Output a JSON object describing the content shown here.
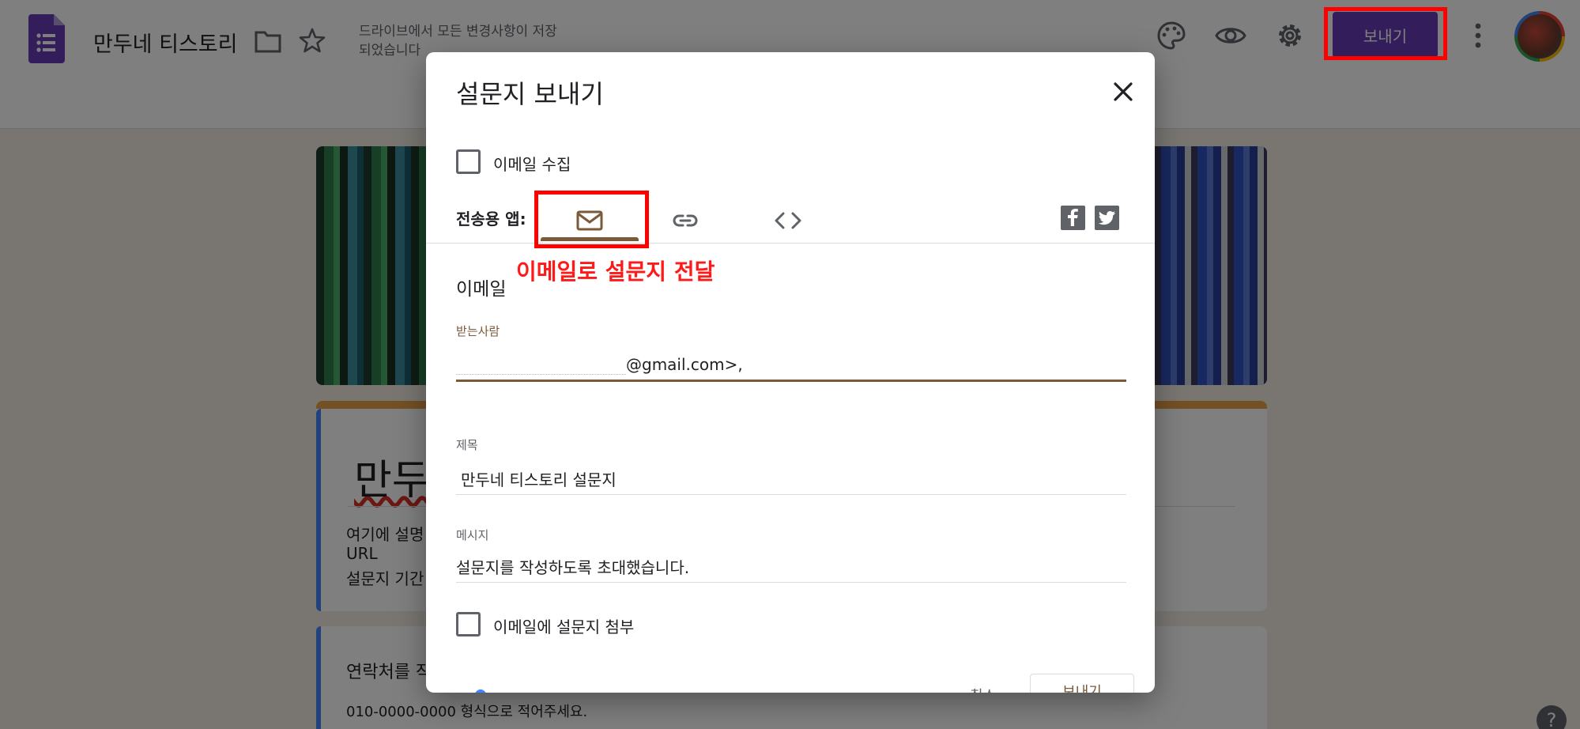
{
  "header": {
    "title": "만두네 티스토리",
    "save_status": "드라이브에서 모든 변경사항이 저장되었습니다",
    "send_label": "보내기",
    "icons": [
      "forms-logo-icon",
      "folder-icon",
      "star-icon",
      "palette-icon",
      "eye-icon",
      "gear-icon",
      "more-vert-icon",
      "avatar"
    ]
  },
  "form": {
    "title_partial": "만두",
    "description_lines": [
      "여기에 설명",
      "URL",
      "설문지 기간"
    ],
    "contact_title": "연락처를 작",
    "contact_help": "010-0000-0000 형식으로 적어주세요."
  },
  "dialog": {
    "title": "설문지 보내기",
    "collect_email_label": "이메일 수집",
    "send_via_label": "전송용 앱:",
    "tabs": [
      {
        "icon": "mail-icon",
        "active": true
      },
      {
        "icon": "link-icon",
        "active": false
      },
      {
        "icon": "embed-code-icon",
        "active": false
      }
    ],
    "annotation": "이메일로 설문지 전달",
    "section_title": "이메일",
    "to": {
      "label": "받는사람",
      "value": "@gmail.com>,"
    },
    "subject": {
      "label": "제목",
      "value": "만두네 티스토리 설문지"
    },
    "message": {
      "label": "메시지",
      "value": "설문지를 작성하도록 초대했습니다."
    },
    "include_form_label": "이메일에 설문지 첨부",
    "cancel_label": "취소",
    "send_label": "보내기"
  },
  "colors": {
    "brand_purple": "#673ab7",
    "accent_brown": "#7b5a3a",
    "highlight_red": "#ff0000",
    "header_accent": "#e8a04a",
    "blue": "#4285f4"
  },
  "help": "?"
}
